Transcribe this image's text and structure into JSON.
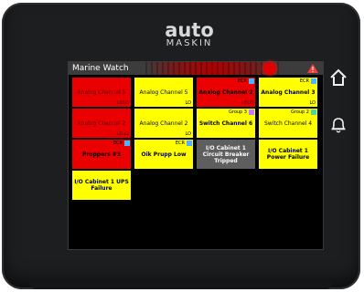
{
  "brand": {
    "name": "auto",
    "sub": "MASKIN"
  },
  "header": {
    "title": "Marine Watch"
  },
  "colors": {
    "alarm_red": "#ea0000",
    "warning_yellow": "#ffff00",
    "inactive_gray": "#5e5e5e"
  },
  "tiles": [
    {
      "name": "Analog Channel 5",
      "group": "",
      "status": "LOLO",
      "color": "red",
      "bold": false,
      "marker": ""
    },
    {
      "name": "Analog Channel 5",
      "group": "",
      "status": "LO",
      "color": "yellow",
      "bold": false,
      "marker": ""
    },
    {
      "name": "Analog Channel 2",
      "group": "ECR",
      "status": "LOLO",
      "color": "red",
      "bold": true,
      "marker": "blue"
    },
    {
      "name": "Analog Channel 3",
      "group": "ECR",
      "status": "LO",
      "color": "yellow",
      "bold": true,
      "marker": "blue"
    },
    {
      "name": "Analog Channel 2",
      "group": "",
      "status": "LOLO",
      "color": "red",
      "bold": false,
      "marker": ""
    },
    {
      "name": "Analog Channel 2",
      "group": "",
      "status": "LO",
      "color": "yellow",
      "bold": false,
      "marker": ""
    },
    {
      "name": "Switch Channel 6",
      "group": "Group 3",
      "status": "",
      "color": "yellow",
      "bold": true,
      "marker": "purple"
    },
    {
      "name": "Switch Channel 4",
      "group": "Group 2",
      "status": "",
      "color": "yellow",
      "bold": false,
      "marker": "green"
    },
    {
      "name": "Proppers #3",
      "group": "ECR",
      "status": "",
      "color": "red",
      "bold": true,
      "marker": "blue"
    },
    {
      "name": "Oik Prupp Low",
      "group": "ECR",
      "status": "",
      "color": "yellow",
      "bold": true,
      "marker": "blue"
    },
    {
      "name": "I/O Cabinet 1 Circuit Breaker Tripped",
      "group": "",
      "status": "",
      "color": "gray",
      "bold": true,
      "marker": ""
    },
    {
      "name": "I/O Cabinet 1 Power Failure",
      "group": "",
      "status": "",
      "color": "yellow",
      "bold": true,
      "marker": ""
    },
    {
      "name": "I/O Cabinet 1 UPS Failure",
      "group": "",
      "status": "",
      "color": "yellow",
      "bold": true,
      "marker": ""
    }
  ],
  "side_buttons": [
    {
      "icon": "home-icon"
    },
    {
      "icon": "bell-icon"
    }
  ]
}
